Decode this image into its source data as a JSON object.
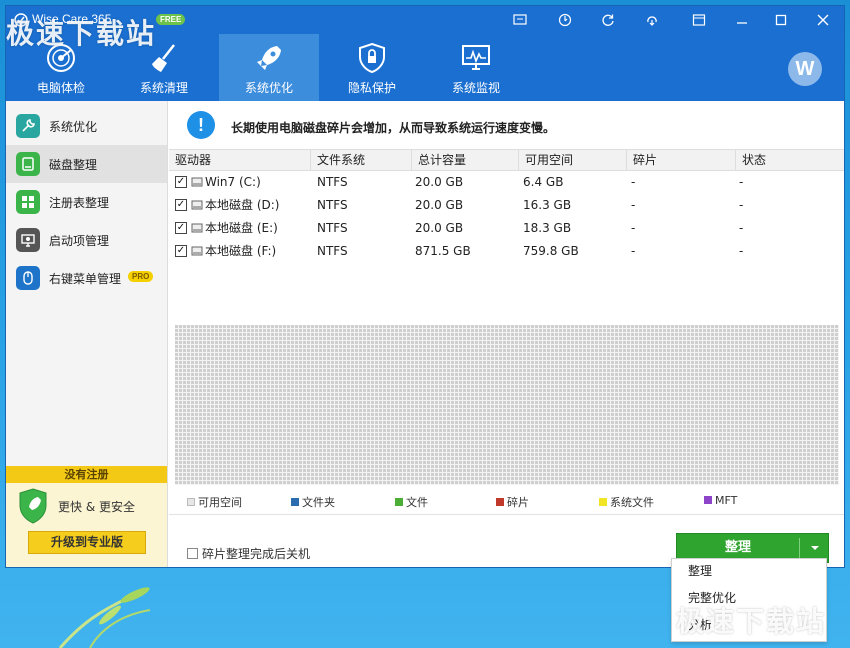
{
  "app": {
    "title": "Wise Care 365",
    "badge": "FREE",
    "window_controls": [
      "message-icon",
      "upgrade-icon",
      "refresh-icon",
      "share-icon",
      "minimize-icon",
      "maximize-icon",
      "close-icon"
    ]
  },
  "nav": {
    "items": [
      {
        "label": "电脑体检",
        "icon": "radar-icon"
      },
      {
        "label": "系统清理",
        "icon": "broom-icon"
      },
      {
        "label": "系统优化",
        "icon": "rocket-icon",
        "active": true
      },
      {
        "label": "隐私保护",
        "icon": "shield-lock-icon"
      },
      {
        "label": "系统监视",
        "icon": "monitor-icon"
      }
    ],
    "avatar_letter": "W"
  },
  "sidebar": {
    "items": [
      {
        "label": "系统优化",
        "icon": "tools-icon",
        "color": "#2aa6a0"
      },
      {
        "label": "磁盘整理",
        "icon": "disk-icon",
        "color": "#3bb54a",
        "active": true
      },
      {
        "label": "注册表整理",
        "icon": "registry-icon",
        "color": "#3bb54a"
      },
      {
        "label": "启动项管理",
        "icon": "startup-icon",
        "color": "#555555"
      },
      {
        "label": "右键菜单管理",
        "icon": "mouse-icon",
        "color": "#1e74c8",
        "badge": "PRO"
      }
    ],
    "registration": {
      "header": "没有注册",
      "text": "更快 & 更安全",
      "upgrade_button": "升级到专业版"
    }
  },
  "main": {
    "info_text": "长期使用电脑磁盘碎片会增加，从而导致系统运行速度变慢。",
    "columns": [
      "驱动器",
      "文件系统",
      "总计容量",
      "可用空间",
      "碎片",
      "状态"
    ],
    "rows": [
      {
        "drive": "Win7 (C:)",
        "fs": "NTFS",
        "total": "20.0 GB",
        "free": "6.4 GB",
        "frag": "-",
        "status": "-",
        "checked": true
      },
      {
        "drive": "本地磁盘 (D:)",
        "fs": "NTFS",
        "total": "20.0 GB",
        "free": "16.3 GB",
        "frag": "-",
        "status": "-",
        "checked": true
      },
      {
        "drive": "本地磁盘 (E:)",
        "fs": "NTFS",
        "total": "20.0 GB",
        "free": "18.3 GB",
        "frag": "-",
        "status": "-",
        "checked": true
      },
      {
        "drive": "本地磁盘 (F:)",
        "fs": "NTFS",
        "total": "871.5 GB",
        "free": "759.8 GB",
        "frag": "-",
        "status": "-",
        "checked": true
      }
    ],
    "legend": [
      {
        "label": "可用空间",
        "color": "#e6e6e6"
      },
      {
        "label": "文件夹",
        "color": "#2b6cb0"
      },
      {
        "label": "文件",
        "color": "#4cae34"
      },
      {
        "label": "碎片",
        "color": "#c0392b"
      },
      {
        "label": "系统文件",
        "color": "#f2e526"
      },
      {
        "label": "MFT",
        "color": "#8e44c9"
      }
    ],
    "shutdown_option": "碎片整理完成后关机",
    "defrag_button": "整理",
    "dropdown_items": [
      "整理",
      "完整优化",
      "分析"
    ]
  },
  "watermark": "极速下载站"
}
